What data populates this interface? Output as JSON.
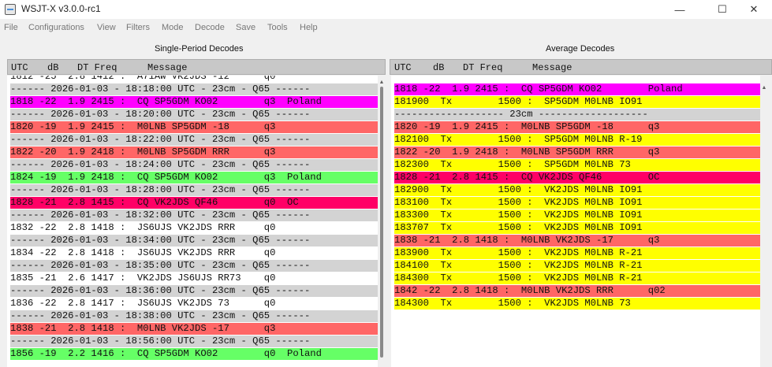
{
  "window": {
    "title": "WSJT-X  v3.0.0-rc1",
    "minimize": "—",
    "maximize": "☐",
    "close": "✕"
  },
  "menu": [
    "File",
    "Configurations",
    "View",
    "Filters",
    "Mode",
    "Decode",
    "Save",
    "Tools",
    "Help"
  ],
  "left_panel": {
    "title": "Single-Period Decodes",
    "columns": {
      "utc": "UTC",
      "db": "dB",
      "dt_freq": "DT Freq",
      "message": "Message"
    },
    "rows": [
      {
        "text": "1812 -25  2.8 1412 :  A71AW VK2JDS -12      q0",
        "bg": "#ffffff"
      },
      {
        "text": "------ 2026-01-03 - 18:18:00 UTC - 23cm - Q65 ------",
        "bg": "#d3d3d3"
      },
      {
        "text": "1818 -22  1.9 2415 :  CQ SP5GDM KO02        q3  Poland",
        "bg": "#ff00ff"
      },
      {
        "text": "------ 2026-01-03 - 18:20:00 UTC - 23cm - Q65 ------",
        "bg": "#d3d3d3"
      },
      {
        "text": "1820 -19  1.9 2415 :  M0LNB SP5GDM -18      q3",
        "bg": "#ff6666"
      },
      {
        "text": "------ 2026-01-03 - 18:22:00 UTC - 23cm - Q65 ------",
        "bg": "#d3d3d3"
      },
      {
        "text": "1822 -20  1.9 2418 :  M0LNB SP5GDM RRR      q3",
        "bg": "#ff6666"
      },
      {
        "text": "------ 2026-01-03 - 18:24:00 UTC - 23cm - Q65 ------",
        "bg": "#d3d3d3"
      },
      {
        "text": "1824 -19  1.9 2418 :  CQ SP5GDM KO02        q3  Poland",
        "bg": "#66ff66"
      },
      {
        "text": "------ 2026-01-03 - 18:28:00 UTC - 23cm - Q65 ------",
        "bg": "#d3d3d3"
      },
      {
        "text": "1828 -21  2.8 1415 :  CQ VK2JDS QF46        q0  OC",
        "bg": "#ff0066"
      },
      {
        "text": "------ 2026-01-03 - 18:32:00 UTC - 23cm - Q65 ------",
        "bg": "#d3d3d3"
      },
      {
        "text": "1832 -22  2.8 1418 :  JS6UJS VK2JDS RRR     q0",
        "bg": "#ffffff"
      },
      {
        "text": "------ 2026-01-03 - 18:34:00 UTC - 23cm - Q65 ------",
        "bg": "#d3d3d3"
      },
      {
        "text": "1834 -22  2.8 1418 :  JS6UJS VK2JDS RRR     q0",
        "bg": "#ffffff"
      },
      {
        "text": "------ 2026-01-03 - 18:35:00 UTC - 23cm - Q65 ------",
        "bg": "#d3d3d3"
      },
      {
        "text": "1835 -21  2.6 1417 :  VK2JDS JS6UJS RR73    q0",
        "bg": "#ffffff"
      },
      {
        "text": "------ 2026-01-03 - 18:36:00 UTC - 23cm - Q65 ------",
        "bg": "#d3d3d3"
      },
      {
        "text": "1836 -22  2.8 1417 :  JS6UJS VK2JDS 73      q0",
        "bg": "#ffffff"
      },
      {
        "text": "------ 2026-01-03 - 18:38:00 UTC - 23cm - Q65 ------",
        "bg": "#d3d3d3"
      },
      {
        "text": "1838 -21  2.8 1418 :  M0LNB VK2JDS -17      q3",
        "bg": "#ff6666"
      },
      {
        "text": "------ 2026-01-03 - 18:56:00 UTC - 23cm - Q65 ------",
        "bg": "#d3d3d3"
      },
      {
        "text": "1856 -19  2.2 1416 :  CQ SP5GDM KO02        q0  Poland",
        "bg": "#66ff66"
      }
    ]
  },
  "right_panel": {
    "title": "Average Decodes",
    "columns": {
      "utc": "UTC",
      "db": "dB",
      "dt_freq": "DT Freq",
      "message": "Message"
    },
    "rows": [
      {
        "text": "1818 -22  1.9 2415 :  CQ SP5GDM KO02        Poland",
        "bg": "#ff00ff"
      },
      {
        "text": "181900  Tx        1500 :  SP5GDM M0LNB IO91",
        "bg": "#ffff00"
      },
      {
        "text": "------------------- 23cm -------------------",
        "bg": "#d3d3d3"
      },
      {
        "text": "1820 -19  1.9 2415 :  M0LNB SP5GDM -18      q3",
        "bg": "#ff6666"
      },
      {
        "text": "182100  Tx        1500 :  SP5GDM M0LNB R-19",
        "bg": "#ffff00"
      },
      {
        "text": "1822 -20  1.9 2418 :  M0LNB SP5GDM RRR      q3",
        "bg": "#ff6666"
      },
      {
        "text": "182300  Tx        1500 :  SP5GDM M0LNB 73",
        "bg": "#ffff00"
      },
      {
        "text": "1828 -21  2.8 1415 :  CQ VK2JDS QF46        OC",
        "bg": "#ff0066"
      },
      {
        "text": "182900  Tx        1500 :  VK2JDS M0LNB IO91",
        "bg": "#ffff00"
      },
      {
        "text": "183100  Tx        1500 :  VK2JDS M0LNB IO91",
        "bg": "#ffff00"
      },
      {
        "text": "183300  Tx        1500 :  VK2JDS M0LNB IO91",
        "bg": "#ffff00"
      },
      {
        "text": "183707  Tx        1500 :  VK2JDS M0LNB IO91",
        "bg": "#ffff00"
      },
      {
        "text": "1838 -21  2.8 1418 :  M0LNB VK2JDS -17      q3",
        "bg": "#ff6666"
      },
      {
        "text": "183900  Tx        1500 :  VK2JDS M0LNB R-21",
        "bg": "#ffff00"
      },
      {
        "text": "184100  Tx        1500 :  VK2JDS M0LNB R-21",
        "bg": "#ffff00"
      },
      {
        "text": "184300  Tx        1500 :  VK2JDS M0LNB R-21",
        "bg": "#ffff00"
      },
      {
        "text": "1842 -22  2.8 1418 :  M0LNB VK2JDS RRR      q02",
        "bg": "#ff6666"
      },
      {
        "text": "184300  Tx        1500 :  VK2JDS M0LNB 73",
        "bg": "#ffff00"
      }
    ]
  },
  "scroll": {
    "left_position": 1.0,
    "right_position": 0.0
  }
}
